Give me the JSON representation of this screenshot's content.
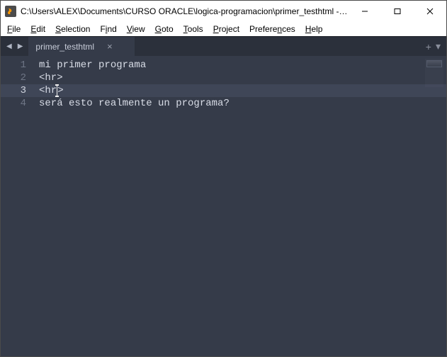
{
  "titlebar": {
    "path": "C:\\Users\\ALEX\\Documents\\CURSO ORACLE\\logica-programacion\\primer_testhtml - Su..."
  },
  "menu": {
    "file": {
      "u": "F",
      "rest": "ile"
    },
    "edit": {
      "u": "E",
      "rest": "dit"
    },
    "selection": {
      "u": "S",
      "rest": "election"
    },
    "find": {
      "pre": "F",
      "u": "i",
      "rest": "nd"
    },
    "view": {
      "u": "V",
      "rest": "iew"
    },
    "goto": {
      "u": "G",
      "rest": "oto"
    },
    "tools": {
      "u": "T",
      "rest": "ools"
    },
    "project": {
      "u": "P",
      "rest": "roject"
    },
    "preferences": {
      "pre": "Prefere",
      "u": "n",
      "rest": "ces"
    },
    "help": {
      "u": "H",
      "rest": "elp"
    }
  },
  "tab": {
    "label": "primer_testhtml"
  },
  "editor": {
    "lines": [
      {
        "num": "1",
        "text": "mi primer programa"
      },
      {
        "num": "2",
        "text": "<hr>"
      },
      {
        "num": "3",
        "text": "<hr>",
        "cursor_after": 3,
        "highlight": true
      },
      {
        "num": "4",
        "text": "será esto realmente un programa?"
      }
    ]
  },
  "tabright": {
    "plus": "+",
    "down": "▾"
  }
}
